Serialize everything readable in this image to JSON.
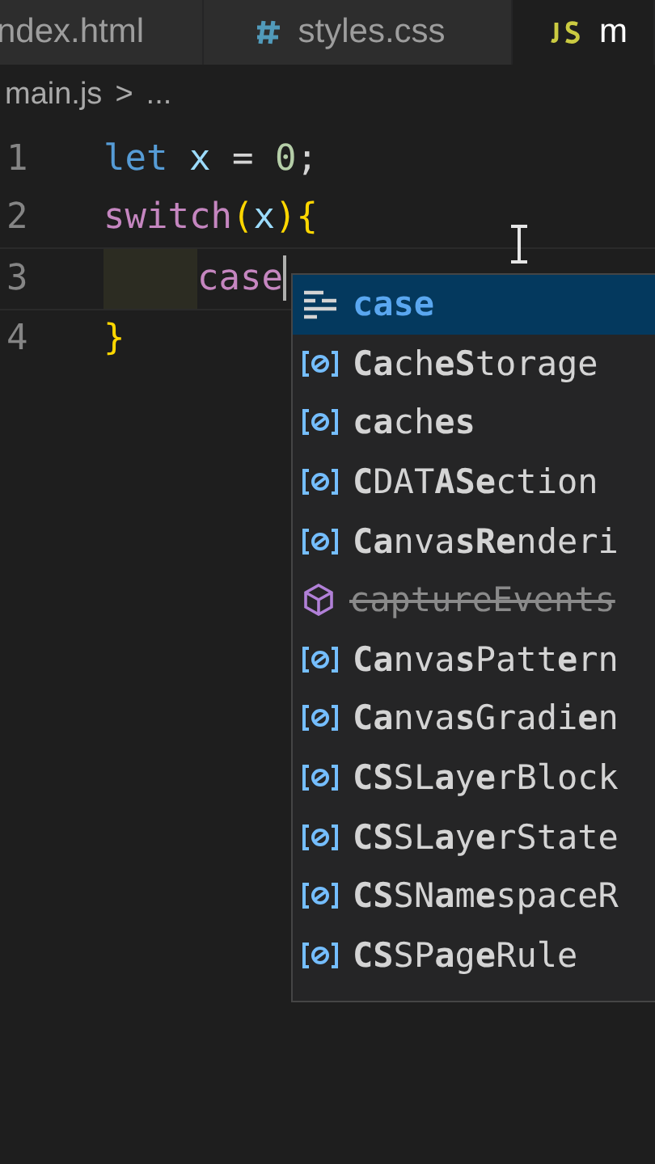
{
  "tabs": [
    {
      "label": "ndex.html",
      "kind": "html",
      "selected": false
    },
    {
      "label": "styles.css",
      "kind": "css",
      "selected": false
    },
    {
      "label": "m",
      "kind": "js",
      "selected": true
    }
  ],
  "breadcrumb": {
    "file": "main.js",
    "separator": ">",
    "rest": "..."
  },
  "editor": {
    "lines": [
      {
        "number": "1",
        "indented": false,
        "tokens": [
          {
            "text": "let",
            "kind": "keyword"
          },
          {
            "text": " x",
            "kind": "variable"
          },
          {
            "text": " = ",
            "kind": "plain"
          },
          {
            "text": "0",
            "kind": "number"
          },
          {
            "text": ";",
            "kind": "plain"
          }
        ]
      },
      {
        "number": "2",
        "indented": false,
        "tokens": [
          {
            "text": "switch",
            "kind": "control"
          },
          {
            "text": "(",
            "kind": "bracket"
          },
          {
            "text": "x",
            "kind": "variable"
          },
          {
            "text": ")",
            "kind": "bracket"
          },
          {
            "text": "{",
            "kind": "bracket"
          }
        ]
      },
      {
        "number": "3",
        "indented": true,
        "cursor": true,
        "tokens": [
          {
            "text": "case",
            "kind": "control"
          }
        ]
      },
      {
        "number": "4",
        "indented": false,
        "tokens": [
          {
            "text": "}",
            "kind": "bracket"
          }
        ]
      }
    ]
  },
  "suggestions": [
    {
      "label": "**case**",
      "kind": "keyword",
      "selected": true,
      "deprecated": false
    },
    {
      "label": "**Ca**ch**eS**torage",
      "kind": "variable",
      "selected": false,
      "deprecated": false
    },
    {
      "label": "**ca**ch**es**",
      "kind": "variable",
      "selected": false,
      "deprecated": false
    },
    {
      "label": "**C**DAT**ASe**ction",
      "kind": "variable",
      "selected": false,
      "deprecated": false
    },
    {
      "label": "**Ca**nva**sRe**nderi",
      "kind": "variable",
      "selected": false,
      "deprecated": false
    },
    {
      "label": "captureEvents",
      "kind": "method",
      "selected": false,
      "deprecated": true
    },
    {
      "label": "**Ca**nva**s**Patt**e**rn",
      "kind": "variable",
      "selected": false,
      "deprecated": false
    },
    {
      "label": "**Ca**nva**s**Gradi**e**n",
      "kind": "variable",
      "selected": false,
      "deprecated": false
    },
    {
      "label": "**CS**SL**a**y**e**rBlock",
      "kind": "variable",
      "selected": false,
      "deprecated": false
    },
    {
      "label": "**CS**SL**a**y**e**rState",
      "kind": "variable",
      "selected": false,
      "deprecated": false
    },
    {
      "label": "**CS**SN**a**m**e**spaceR",
      "kind": "variable",
      "selected": false,
      "deprecated": false
    },
    {
      "label": "**CS**SP**a**g**e**Rule",
      "kind": "variable",
      "selected": false,
      "deprecated": false
    }
  ]
}
